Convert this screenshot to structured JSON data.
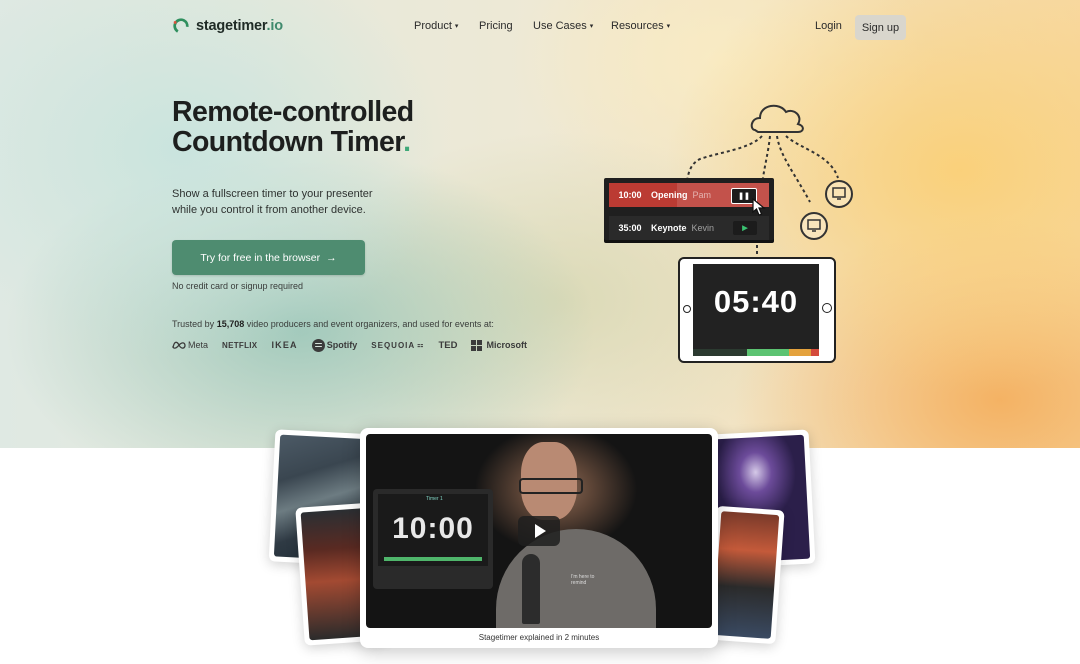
{
  "brand": {
    "name_main": "stagetimer",
    "name_suffix": ".io"
  },
  "nav": {
    "items": [
      {
        "label": "Product",
        "caret": "▾"
      },
      {
        "label": "Pricing",
        "caret": ""
      },
      {
        "label": "Use Cases",
        "caret": "▾"
      },
      {
        "label": "Resources",
        "caret": "▾"
      }
    ],
    "login": "Login",
    "signup": "Sign up"
  },
  "hero": {
    "title_line1": "Remote-controlled",
    "title_line2": "Countdown Timer",
    "title_dot": ".",
    "subtitle": "Show a fullscreen timer to your presenter while you control it from another device.",
    "cta": "Try for free in the browser",
    "cta_arrow": "→",
    "no_cc": "No credit card or signup required",
    "trusted_prefix": "Trusted by",
    "trusted_count": "15,708",
    "trusted_suffix": "video producers and event organizers, and used for events at:",
    "brands": [
      "Meta",
      "NETFLIX",
      "IKEA",
      "Spotify",
      "SEQUOIA",
      "TED",
      "Microsoft"
    ],
    "sequoia_suffix": "⚏"
  },
  "illustration": {
    "rows": [
      {
        "time": "10:00",
        "name": "Opening",
        "speaker": "Pam",
        "button": "❚❚"
      },
      {
        "time": "35:00",
        "name": "Keynote",
        "speaker": "Kevin",
        "button": "▶"
      }
    ],
    "tablet_time": "05:40",
    "colors": {
      "active_row": "#bb3b33",
      "green": "#5cc372",
      "orange": "#e4a23d",
      "red": "#d44b3c"
    }
  },
  "video": {
    "timer_label": "Timer 1",
    "timer_value": "10:00",
    "shirt_text": "I'm here to remind",
    "caption": "Stagetimer explained in 2 minutes"
  },
  "colors": {
    "accent": "#4e8c70",
    "highlight": "#58c493"
  }
}
